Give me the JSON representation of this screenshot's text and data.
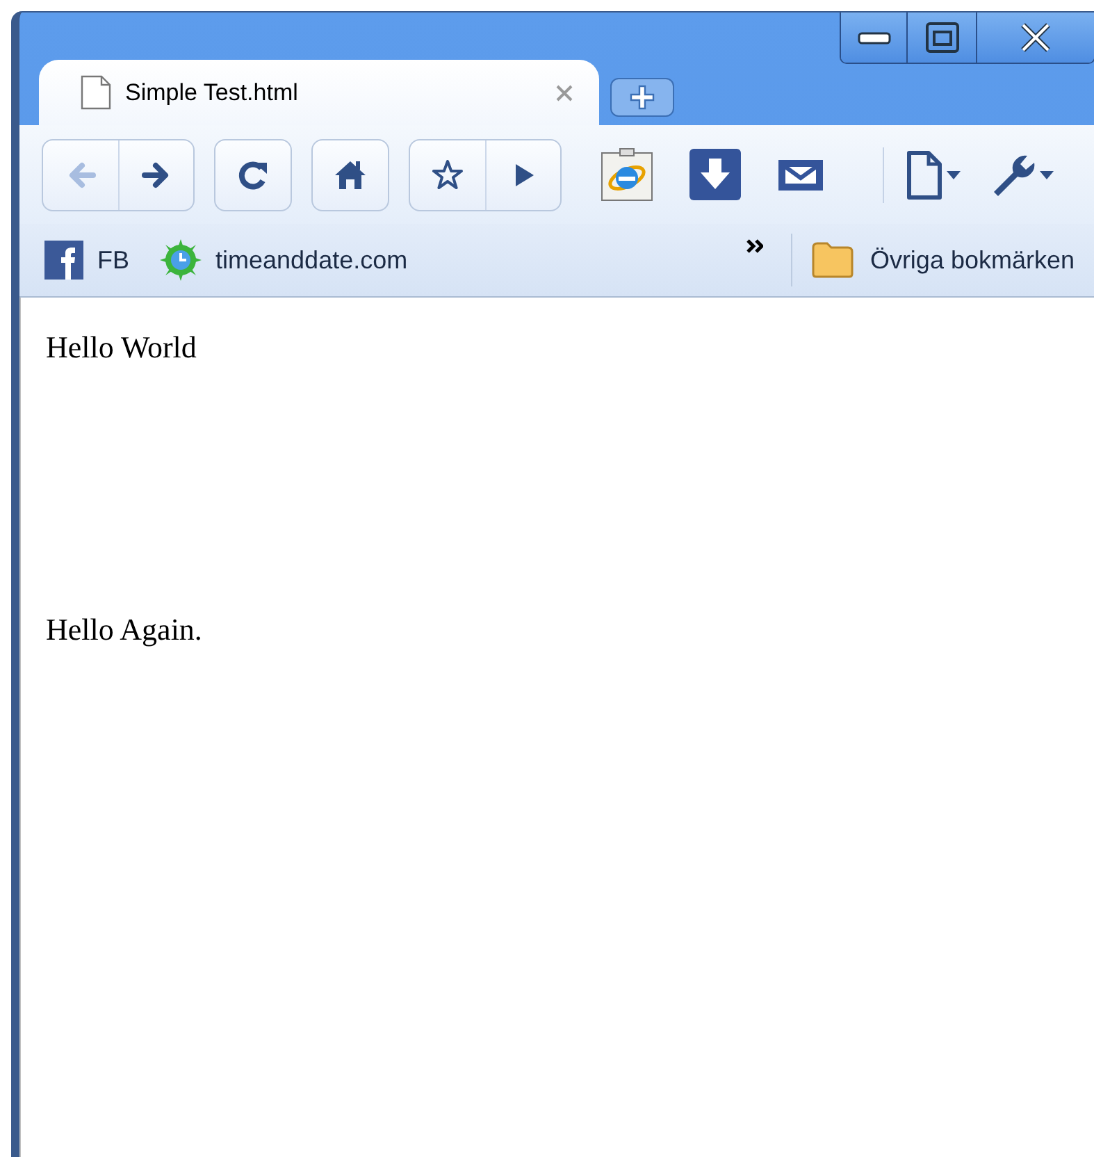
{
  "tabs": [
    {
      "title": "Simple Test.html",
      "selected": true
    }
  ],
  "toolbar": {
    "buttons": [
      {
        "kind": "back",
        "disabled": true
      },
      {
        "kind": "forward",
        "disabled": false
      },
      {
        "kind": "reload",
        "disabled": false
      },
      {
        "kind": "home",
        "disabled": false
      },
      {
        "kind": "star",
        "disabled": false
      },
      {
        "kind": "play",
        "disabled": false
      }
    ]
  },
  "bookmarks": [
    {
      "kind": "facebook",
      "label": "FB"
    },
    {
      "kind": "clock",
      "label": "timeanddate.com"
    }
  ],
  "other_bookmarks": {
    "label": "Övriga bokmärken"
  },
  "content": [
    "Hello World",
    "Hello Again."
  ]
}
